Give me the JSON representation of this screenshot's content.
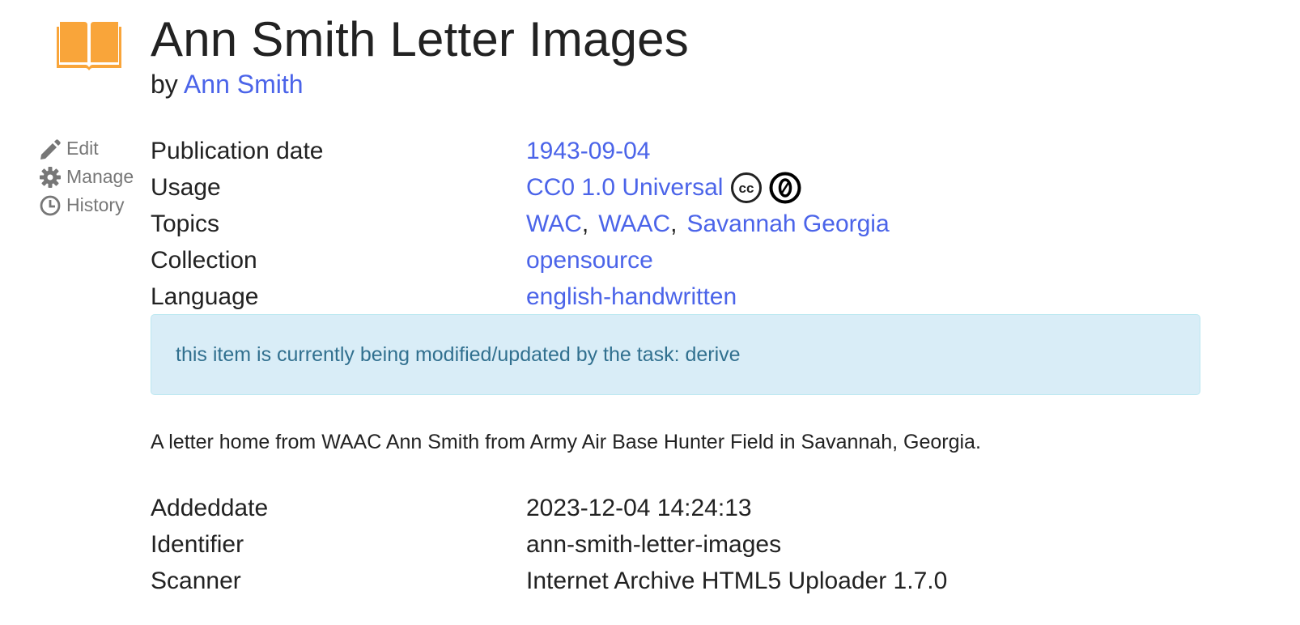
{
  "item": {
    "title": "Ann Smith Letter Images",
    "by_prefix": "by",
    "author": "Ann Smith"
  },
  "actions": [
    {
      "label": "Edit",
      "icon": "pencil-icon"
    },
    {
      "label": "Manage",
      "icon": "gear-icon"
    },
    {
      "label": "History",
      "icon": "clock-icon"
    }
  ],
  "metadata": {
    "publication_date": {
      "key": "Publication date",
      "value": "1943-09-04"
    },
    "usage": {
      "key": "Usage",
      "value": "CC0 1.0 Universal",
      "badges": [
        "cc-icon",
        "zero-icon"
      ]
    },
    "topics": {
      "key": "Topics",
      "values": [
        "WAC",
        "WAAC",
        "Savannah Georgia"
      ],
      "separator": ","
    },
    "collection": {
      "key": "Collection",
      "value": "opensource"
    },
    "language": {
      "key": "Language",
      "value": "english-handwritten"
    }
  },
  "notice": "this item is currently being modified/updated by the task: derive",
  "description": "A letter home from WAAC Ann Smith from Army Air Base Hunter Field in Savannah, Georgia.",
  "details": {
    "addeddate": {
      "key": "Addeddate",
      "value": "2023-12-04 14:24:13"
    },
    "identifier": {
      "key": "Identifier",
      "value": "ann-smith-letter-images"
    },
    "scanner": {
      "key": "Scanner",
      "value": "Internet Archive HTML5 Uploader 1.7.0"
    }
  },
  "colors": {
    "link": "#4b64e9",
    "book_icon": "#f9a53a",
    "notice_bg": "#d9edf7",
    "notice_text": "#31708f",
    "action_text": "#777777"
  }
}
